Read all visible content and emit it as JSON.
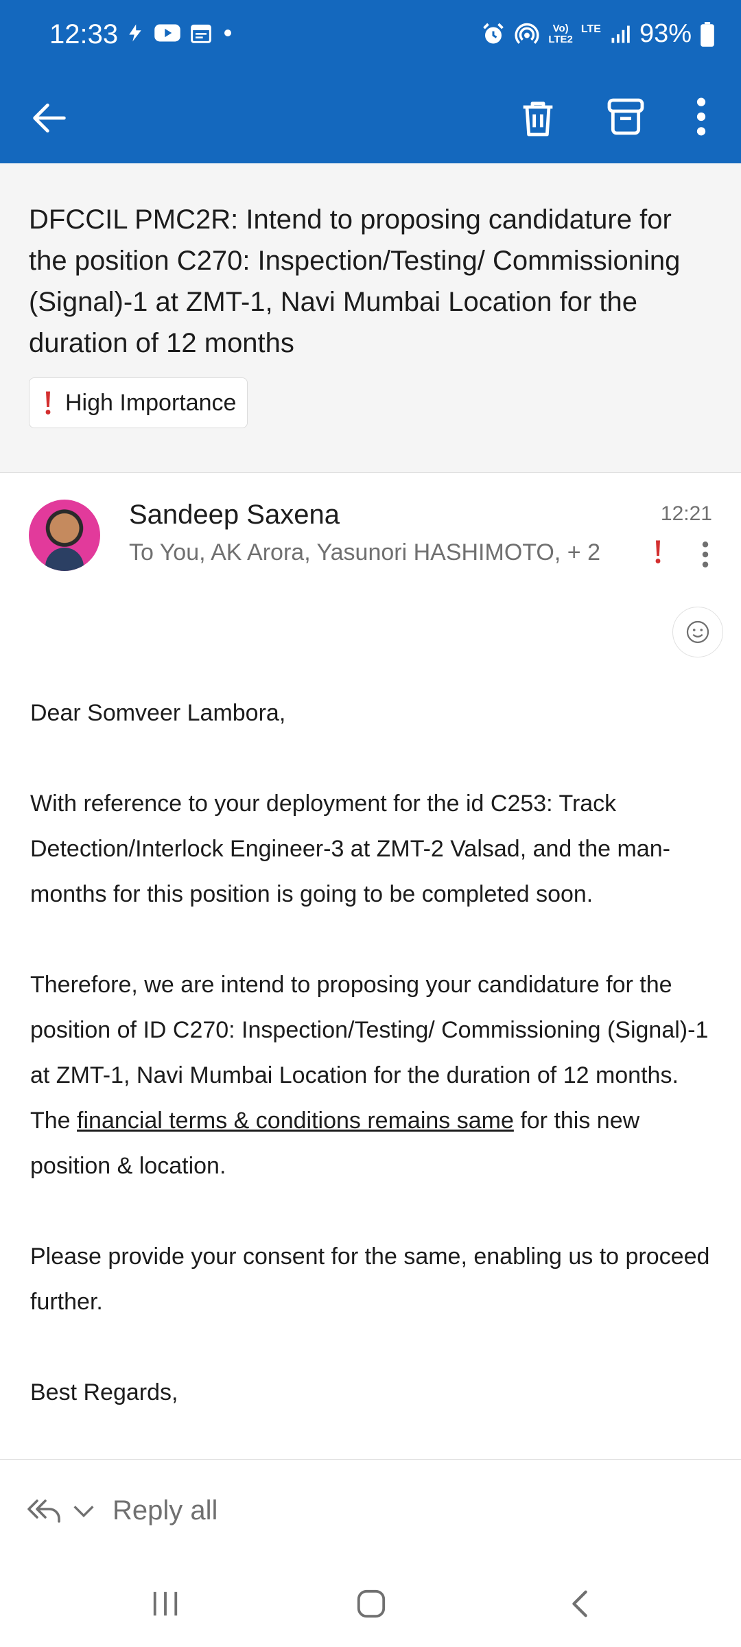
{
  "status_bar": {
    "time": "12:33",
    "battery": "93%",
    "net_vo": "Vo)",
    "net_lte2": "LTE2",
    "net_lte": "LTE",
    "left_icons": [
      "bolt-icon",
      "youtube-icon",
      "calendar-icon",
      "dot-icon"
    ],
    "right_icons": [
      "alarm-icon",
      "hotspot-icon",
      "signal-icon",
      "battery-icon"
    ]
  },
  "app_bar": {
    "icons": [
      "back-arrow-icon",
      "trash-icon",
      "archive-icon",
      "more-vertical-icon"
    ]
  },
  "email": {
    "subject": "DFCCIL PMC2R: Intend to proposing candidature for the position C270: Inspection/Testing/ Commissioning (Signal)-1 at ZMT-1, Navi Mumbai Location for the duration of 12 months",
    "importance_label": "High Importance",
    "sender": "Sandeep Saxena",
    "recipients": "To You, AK Arora, Yasunori HASHIMOTO, + 2",
    "time": "12:21",
    "body": {
      "greeting": "Dear Somveer  Lambora,",
      "p1": "With reference to your deployment for the id C253: Track Detection/Interlock Engineer-3 at ZMT-2 Valsad, and the man-months for this position is going to be completed soon.",
      "p2_start": "Therefore, we are intend to proposing your candidature for the position of ID C270: Inspection/Testing/ Commissioning (Signal)-1 at ZMT-1, Navi Mumbai Location for the duration of 12 months.  The ",
      "p2_link": "financial terms & conditions remains same",
      "p2_end": " for this new position & location.",
      "p3": "Please provide your consent for the same, enabling us to proceed further.",
      "closing": "Best Regards,"
    }
  },
  "reply_bar": {
    "label": "Reply all"
  },
  "colors": {
    "brand": "#1468be",
    "importance_red": "#d32f2f"
  }
}
